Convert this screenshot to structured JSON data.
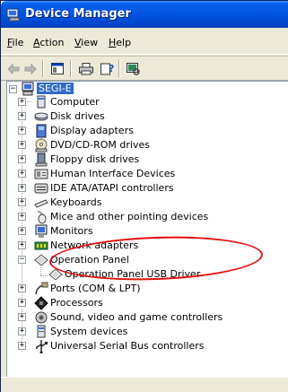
{
  "window": {
    "title": "Device Manager",
    "title_bar_color": "#0054e3"
  },
  "menu": [
    {
      "label": "File",
      "underline": "F",
      "rest": "ile"
    },
    {
      "label": "Action",
      "underline": "A",
      "rest": "ction"
    },
    {
      "label": "View",
      "underline": "V",
      "rest": "iew"
    },
    {
      "label": "Help",
      "underline": "H",
      "rest": "elp"
    }
  ],
  "toolbar": {
    "buttons": [
      "back-arrow-icon",
      "forward-arrow-icon",
      "properties-console-icon",
      "print-icon",
      "help-icon",
      "scan-hardware-icon"
    ]
  },
  "tree": {
    "root": "SEGI-E",
    "items": [
      {
        "label": "Computer",
        "icon": "computer-icon",
        "expander": "+"
      },
      {
        "label": "Disk drives",
        "icon": "disk-drive-icon",
        "expander": "+"
      },
      {
        "label": "Display adapters",
        "icon": "display-adapter-icon",
        "expander": "+"
      },
      {
        "label": "DVD/CD-ROM drives",
        "icon": "cdrom-icon",
        "expander": "+"
      },
      {
        "label": "Floppy disk drives",
        "icon": "floppy-icon",
        "expander": "+"
      },
      {
        "label": "Human Interface Devices",
        "icon": "hid-icon",
        "expander": "+"
      },
      {
        "label": "IDE ATA/ATAPI controllers",
        "icon": "ide-controller-icon",
        "expander": "+"
      },
      {
        "label": "Keyboards",
        "icon": "keyboard-icon",
        "expander": "+"
      },
      {
        "label": "Mice and other pointing devices",
        "icon": "mouse-icon",
        "expander": "+"
      },
      {
        "label": "Monitors",
        "icon": "monitor-icon",
        "expander": "+"
      },
      {
        "label": "Network adapters",
        "icon": "network-adapter-icon",
        "expander": "+"
      },
      {
        "label": "Operation Panel",
        "icon": "operation-panel-icon",
        "expander": "-"
      },
      {
        "label": "Operation Panel USB Driver",
        "icon": "operation-panel-icon",
        "child": true
      },
      {
        "label": "Ports (COM & LPT)",
        "icon": "port-icon",
        "expander": "+"
      },
      {
        "label": "Processors",
        "icon": "processor-icon",
        "expander": "+"
      },
      {
        "label": "Sound, video and game controllers",
        "icon": "sound-icon",
        "expander": "+"
      },
      {
        "label": "System devices",
        "icon": "system-device-icon",
        "expander": "+"
      },
      {
        "label": "Universal Serial Bus controllers",
        "icon": "usb-icon",
        "expander": "+"
      }
    ]
  },
  "annotation_color": "#e01010"
}
